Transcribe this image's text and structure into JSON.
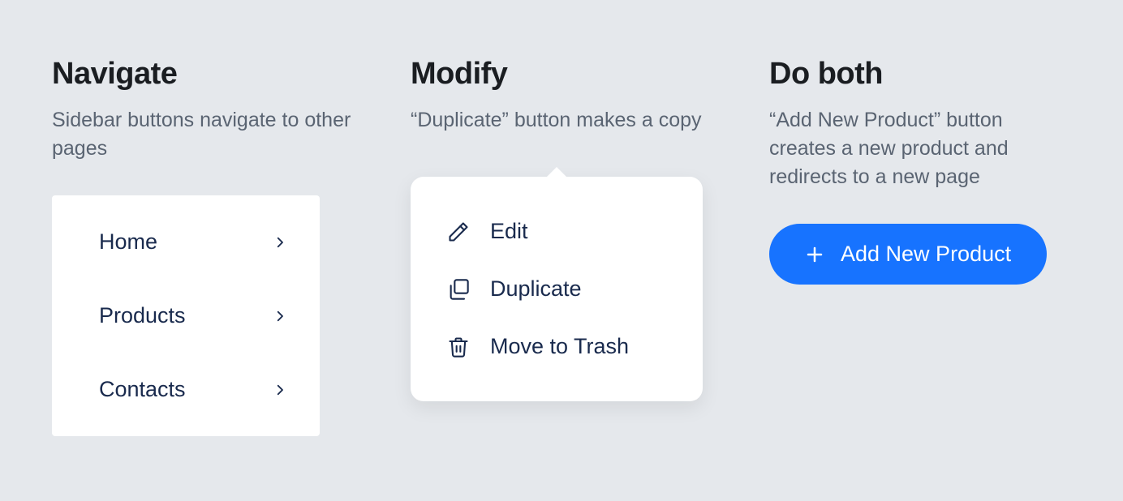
{
  "columns": {
    "navigate": {
      "title": "Navigate",
      "subtitle": "Sidebar buttons navigate to other pages",
      "items": [
        {
          "label": "Home"
        },
        {
          "label": "Products"
        },
        {
          "label": "Contacts"
        }
      ]
    },
    "modify": {
      "title": "Modify",
      "subtitle": "“Duplicate” button makes a copy",
      "menu": [
        {
          "label": "Edit",
          "icon": "pencil"
        },
        {
          "label": "Duplicate",
          "icon": "copy"
        },
        {
          "label": "Move to Trash",
          "icon": "trash"
        }
      ]
    },
    "doboth": {
      "title": "Do both",
      "subtitle": "“Add New Product” button creates a new product and redirects to a new page",
      "button_label": "Add New Product"
    }
  },
  "colors": {
    "primary": "#1773ff",
    "text_dark": "#192a4d",
    "text_muted": "#5a6472",
    "background": "#e5e8ec"
  }
}
